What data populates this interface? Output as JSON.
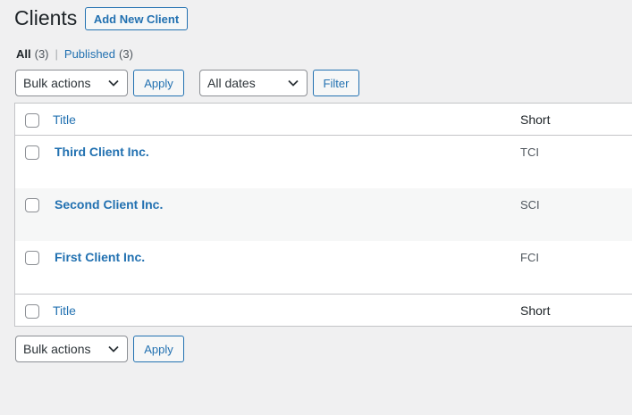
{
  "header": {
    "title": "Clients",
    "add_new_label": "Add New Client"
  },
  "filters": {
    "all_label": "All",
    "all_count": "(3)",
    "separator": "|",
    "published_label": "Published",
    "published_count": "(3)"
  },
  "top_nav": {
    "bulk_actions": "Bulk actions",
    "apply_label": "Apply",
    "dates": "All dates",
    "filter_label": "Filter"
  },
  "table": {
    "columns": [
      "Title",
      "Short"
    ],
    "rows": [
      {
        "title": "Third Client Inc.",
        "short": "TCI"
      },
      {
        "title": "Second Client Inc.",
        "short": "SCI"
      },
      {
        "title": "First Client Inc.",
        "short": "FCI"
      }
    ]
  },
  "bottom_nav": {
    "bulk_actions": "Bulk actions",
    "apply_label": "Apply"
  },
  "colors": {
    "accent": "#2271b1",
    "background": "#f0f0f1",
    "row_alt": "#f6f7f7"
  },
  "icons": {
    "select_chevron": "chevron-down-icon"
  }
}
